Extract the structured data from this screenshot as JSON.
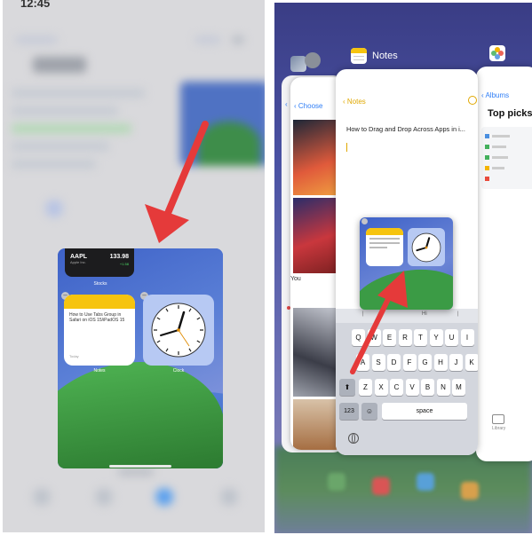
{
  "left_panel": {
    "status_time": "12:45",
    "stocks_widget": {
      "symbol": "AAPL",
      "subtitle": "Apple Inc.",
      "price": "133.98",
      "change": "+1.58",
      "label": "Stocks"
    },
    "notes_widget": {
      "text": "How to Use Tabs Group in Safari on iOS 15/iPadOS 15",
      "date": "Today",
      "label": "Notes"
    },
    "clock_widget": {
      "label": "Clock"
    }
  },
  "right_panel": {
    "app_switcher_title": "Notes",
    "photos_card": {
      "back_label": "Choose",
      "you_label": "You"
    },
    "notes_card": {
      "back_label": "Notes",
      "heading": "How to Drag and Drop Across Apps in i..."
    },
    "albums_card": {
      "back_label": "Albums",
      "title": "Top picks",
      "library_label": "Library"
    },
    "keyboard": {
      "suggestion_mid": "Hi",
      "row1": [
        "Q",
        "W",
        "E",
        "R",
        "T",
        "Y",
        "U",
        "I"
      ],
      "row2": [
        "A",
        "S",
        "D",
        "F",
        "G",
        "H",
        "J",
        "K"
      ],
      "row3": [
        "Z",
        "X",
        "C",
        "V",
        "B",
        "N",
        "M"
      ],
      "numbers_key": "123",
      "space_key": "space"
    }
  },
  "colors": {
    "arrow": "#e53a3a",
    "notes_yellow": "#f6c40f",
    "ios_blue": "#2f7ef6",
    "wallpaper_blue": "#4a72d0",
    "wallpaper_green": "#2e7d32"
  },
  "icons": [
    "red-arrow",
    "clock-icon",
    "notes-app-icon",
    "photos-app-icon",
    "globe-icon",
    "shift-icon",
    "emoji-icon",
    "library-icon"
  ]
}
